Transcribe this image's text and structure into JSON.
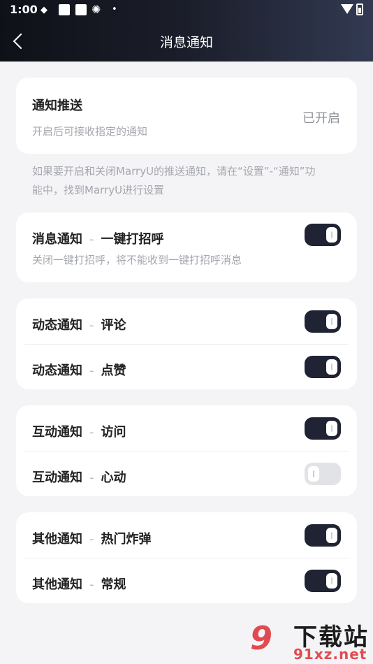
{
  "status_bar": {
    "time": "1:00"
  },
  "header": {
    "title": "消息通知"
  },
  "push": {
    "title": "通知推送",
    "desc": "开启后可接收指定的通知",
    "value": "已开启"
  },
  "hint": {
    "line1": "如果要开启和关闭MarryU的推送通知，请在“设置”-“通知”功",
    "line2": "能中，找到MarryU进行设置"
  },
  "sections": [
    {
      "rows": [
        {
          "category": "消息通知",
          "item": "一键打招呼",
          "desc": "关闭一键打招呼，将不能收到一键打招呼消息",
          "on": true
        }
      ]
    },
    {
      "rows": [
        {
          "category": "动态通知",
          "item": "评论",
          "on": true
        },
        {
          "category": "动态通知",
          "item": "点赞",
          "on": true
        }
      ]
    },
    {
      "rows": [
        {
          "category": "互动通知",
          "item": "访问",
          "on": true
        },
        {
          "category": "互动通知",
          "item": "心动",
          "on": false
        }
      ]
    },
    {
      "rows": [
        {
          "category": "其他通知",
          "item": "热门炸弹",
          "on": true
        },
        {
          "category": "其他通知",
          "item": "常规",
          "on": true
        }
      ]
    }
  ],
  "separator": "-",
  "watermark": {
    "nine": "9",
    "line1": "下载站",
    "line2": "91xz.net"
  },
  "colors": {
    "toggle_on": "#1f2333",
    "toggle_off": "#e2e3e6",
    "header_dark": "#0f1118",
    "header_light": "#323a52"
  }
}
